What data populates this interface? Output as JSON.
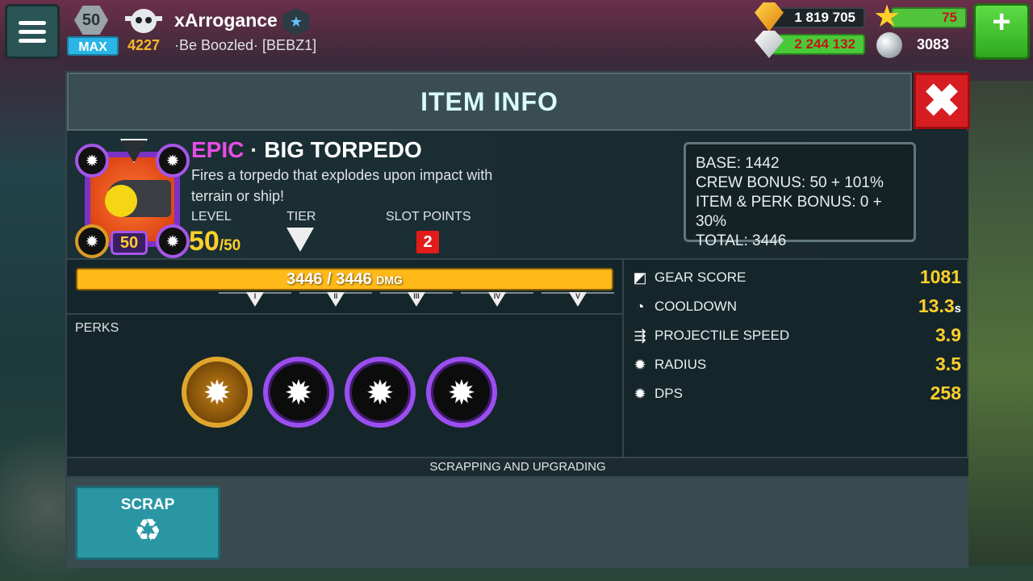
{
  "header": {
    "level": "50",
    "max_label": "MAX",
    "trophies": "4227",
    "player_name": "xArrogance",
    "clan": "·Be Boozled· [BEBZ1]",
    "gold": "1 819 705",
    "gems": "2 244 132",
    "stars": "75",
    "pearls": "3083"
  },
  "panel": {
    "title": "ITEM INFO",
    "item": {
      "rarity": "EPIC",
      "separator": "·",
      "name": "BIG TORPEDO",
      "description": "Fires a torpedo that explodes upon impact with terrain or ship!",
      "level_label": "LEVEL",
      "level": "50",
      "level_max": "/50",
      "tier_label": "TIER",
      "tier_chip": "V",
      "slot_points_label": "SLOT POINTS",
      "slot_points": "2",
      "badge_level": "50"
    },
    "bonus": {
      "base": "BASE: 1442",
      "crew": "CREW BONUS: 50 + 101%",
      "item_perk": "ITEM & PERK BONUS: 0 + 30%",
      "total": "TOTAL: 3446"
    },
    "damage": {
      "text": "3446 / 3446",
      "unit": "DMG",
      "fill_fraction": 1.0,
      "tiers": [
        "I",
        "II",
        "III",
        "IV",
        "V"
      ]
    },
    "perks_label": "PERKS",
    "stats": [
      {
        "name": "GEAR SCORE",
        "value": "1081",
        "unit": "",
        "icon": "gear-score-icon"
      },
      {
        "name": "COOLDOWN",
        "value": "13.3",
        "unit": "s",
        "icon": "cooldown-icon"
      },
      {
        "name": "PROJECTILE SPEED",
        "value": "3.9",
        "unit": "",
        "icon": "speed-icon"
      },
      {
        "name": "RADIUS",
        "value": "3.5",
        "unit": "",
        "icon": "radius-icon"
      },
      {
        "name": "DPS",
        "value": "258",
        "unit": "",
        "icon": "dps-icon"
      }
    ],
    "scrap_header": "SCRAPPING AND UPGRADING",
    "scrap_label": "SCRAP"
  },
  "colors": {
    "epic": "#e94de6",
    "gold_value": "#ffcf2a",
    "damage_bar": "#ffba1a",
    "close": "#d61d22",
    "scrap": "#2a96a4"
  }
}
